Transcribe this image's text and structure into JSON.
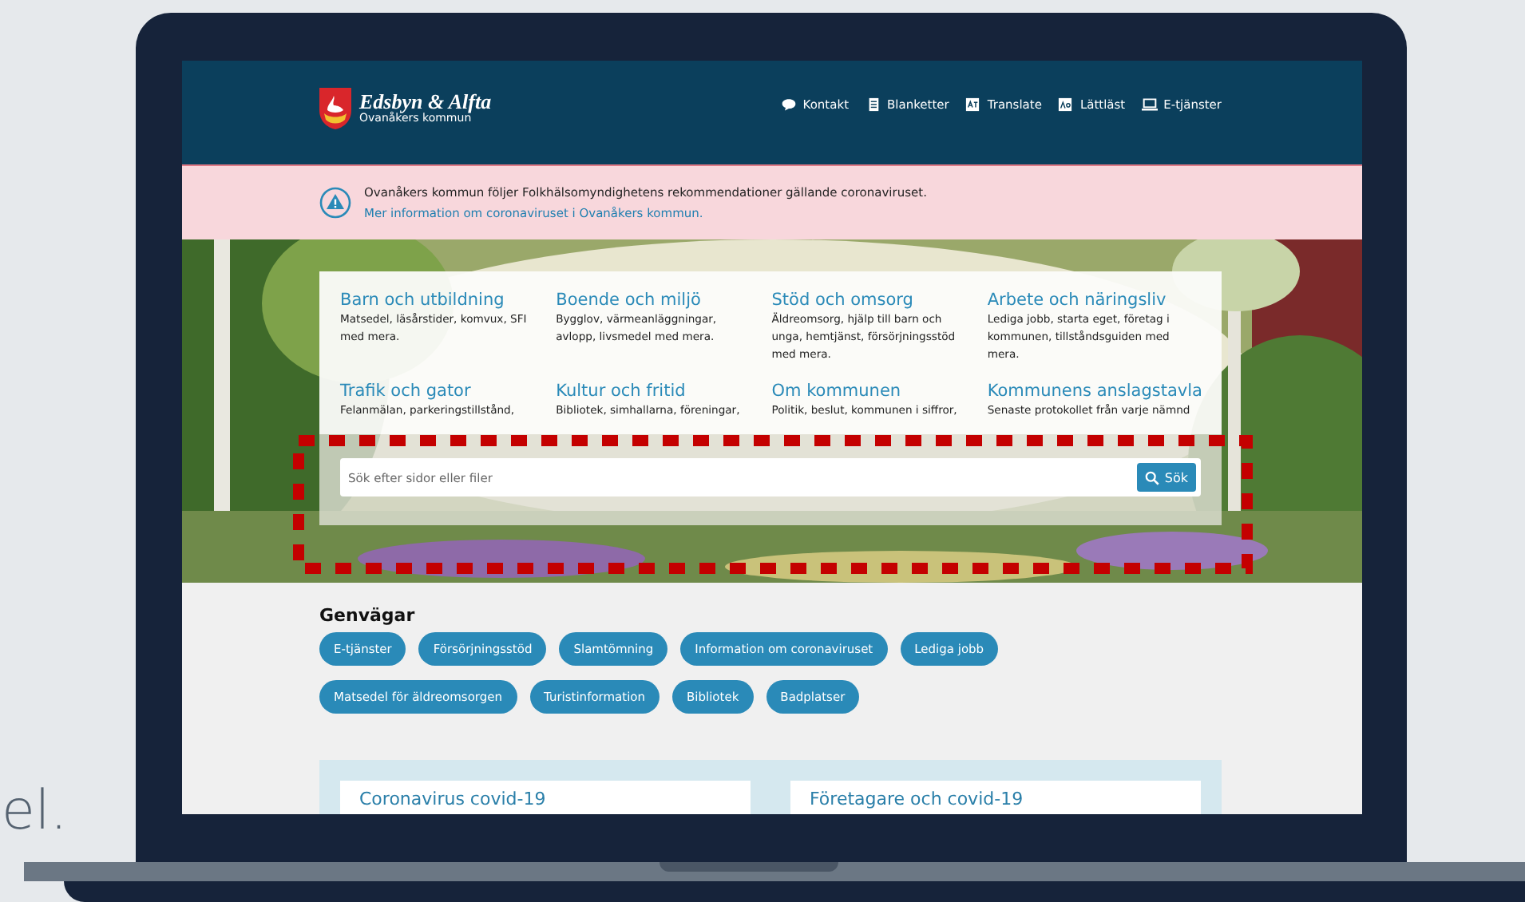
{
  "background_text": "el.",
  "site": {
    "logo": {
      "title": "Edsbyn & Alfta",
      "subtitle": "Ovanåkers kommun"
    },
    "nav": [
      {
        "label": "Kontakt",
        "kind": "chat"
      },
      {
        "label": "Blanketter",
        "kind": "document"
      },
      {
        "label": "Translate",
        "kind": "translate"
      },
      {
        "label": "Lättläst",
        "kind": "easyread"
      },
      {
        "label": "E-tjänster",
        "kind": "computer"
      }
    ]
  },
  "alert": {
    "text": "Ovanåkers kommun följer Folkhälsomyndighetens rekommendationer gällande coronaviruset.",
    "link": "Mer information om coronaviruset i Ovanåkers kommun."
  },
  "categories": [
    {
      "title": "Barn och utbildning",
      "description": "Matsedel, läsårstider, komvux, SFI med mera."
    },
    {
      "title": "Boende och miljö",
      "description": "Bygglov, värmeanläggningar, avlopp, livsmedel med mera."
    },
    {
      "title": "Stöd och omsorg",
      "description": "Äldreomsorg, hjälp till barn och unga, hemtjänst, försörjningsstöd med mera."
    },
    {
      "title": "Arbete och näringsliv",
      "description": "Lediga jobb, starta eget, företag i kommunen, tillståndsguiden med mera."
    },
    {
      "title": "Trafik och gator",
      "description": "Felanmälan, parkeringstillstånd,"
    },
    {
      "title": "Kultur och fritid",
      "description": "Bibliotek, simhallarna, föreningar,"
    },
    {
      "title": "Om kommunen",
      "description": "Politik, beslut, kommunen i siffror,"
    },
    {
      "title": "Kommunens anslagstavla",
      "description": "Senaste protokollet från varje nämnd"
    }
  ],
  "search": {
    "placeholder": "Sök efter sidor eller filer",
    "button": "Sök"
  },
  "shortcuts": {
    "heading": "Genvägar",
    "items": [
      "E-tjänster",
      "Försörjningsstöd",
      "Slamtömning",
      "Information om coronaviruset",
      "Lediga jobb",
      "Matsedel för äldreomsorgen",
      "Turistinformation",
      "Bibliotek",
      "Badplatser"
    ]
  },
  "cards": [
    {
      "title": "Coronavirus covid-19"
    },
    {
      "title": "Företagare och covid-19"
    }
  ]
}
